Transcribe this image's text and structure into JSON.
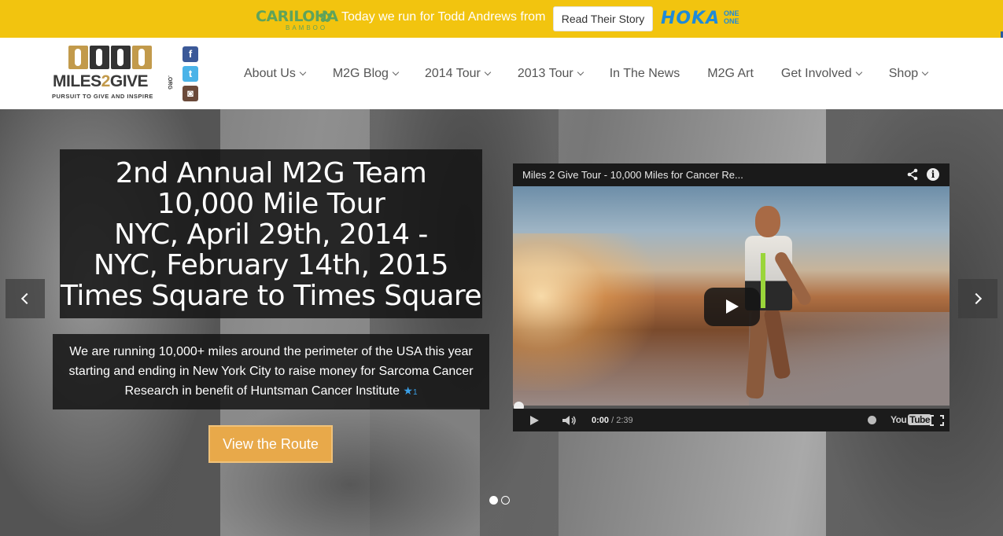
{
  "promo": {
    "sponsor_logo": "CARILOHA",
    "sponsor_sub": "BAMBOO",
    "text": "Today we run for Todd Andrews from",
    "button": "Read Their Story",
    "partner_logo": "HOKA",
    "partner_sub_1": "ONE",
    "partner_sub_2": "ONE",
    "bg_color": "#f2c40f"
  },
  "header": {
    "logo": {
      "name_1": "MILES",
      "name_2": "2",
      "name_3": "GIVE",
      "org": ".ORG",
      "tagline": "PURSUIT TO GIVE AND INSPIRE"
    },
    "social": [
      {
        "icon": "facebook-icon",
        "glyph": "f"
      },
      {
        "icon": "twitter-icon",
        "glyph": "t"
      },
      {
        "icon": "instagram-icon",
        "glyph": "◙"
      }
    ],
    "nav": [
      {
        "label": "About Us",
        "dropdown": true
      },
      {
        "label": "M2G Blog",
        "dropdown": true
      },
      {
        "label": "2014 Tour",
        "dropdown": true
      },
      {
        "label": "2013 Tour",
        "dropdown": true
      },
      {
        "label": "In The News",
        "dropdown": false
      },
      {
        "label": "M2G Art",
        "dropdown": false
      },
      {
        "label": "Get Involved",
        "dropdown": true
      },
      {
        "label": "Shop",
        "dropdown": true
      }
    ]
  },
  "hero": {
    "title_lines": [
      "2nd Annual M2G Team",
      "10,000 Mile Tour",
      "NYC, April 29th, 2014 -",
      "NYC, February 14th, 2015",
      "Times Square to Times Square"
    ],
    "description": "We are running 10,000+ miles around the perimeter of the USA this year starting and ending in New York City to raise money for Sarcoma Cancer Research in benefit of Huntsman Cancer Institute",
    "star": "★",
    "star_count": "1",
    "route_button": "View the Route",
    "slides_total": 2,
    "slide_active": 1
  },
  "video": {
    "title": "Miles 2 Give Tour - 10,000 Miles for Cancer Re...",
    "current_time": "0:00",
    "duration": "/ 2:39",
    "brand": "You",
    "brand_tube": "Tube",
    "info_glyph": "i"
  }
}
